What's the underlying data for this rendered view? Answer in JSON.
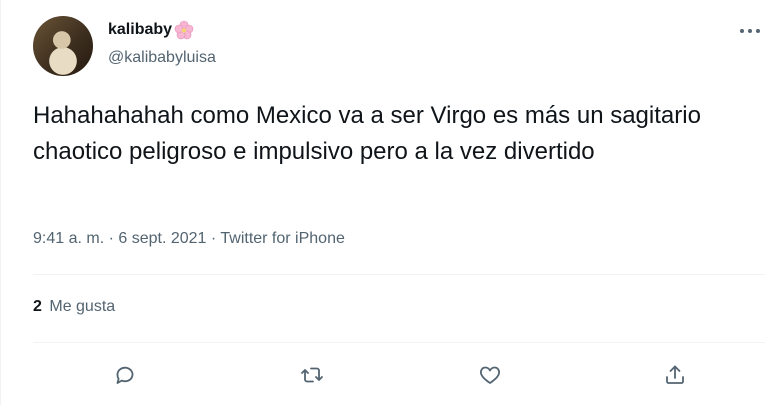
{
  "user": {
    "name": "kalibaby",
    "handle": "@kalibabyluisa",
    "name_emoji": "cherry-blossom-icon"
  },
  "tweet": {
    "text": "Hahahahahah como Mexico va a ser Virgo es más un sagitario chaotico peligroso e impulsivo pero a la vez divertido",
    "meta": "9:41 a. m. · 6 sept. 2021 · Twitter for iPhone"
  },
  "stats": {
    "likes_count": "2",
    "likes_label": "Me gusta"
  },
  "actions": [
    {
      "icon": "reply-icon"
    },
    {
      "icon": "retweet-icon"
    },
    {
      "icon": "like-icon"
    },
    {
      "icon": "share-icon"
    }
  ],
  "colors": {
    "text": "#0f1419",
    "secondary": "#536471",
    "divider": "#eff3f4"
  }
}
